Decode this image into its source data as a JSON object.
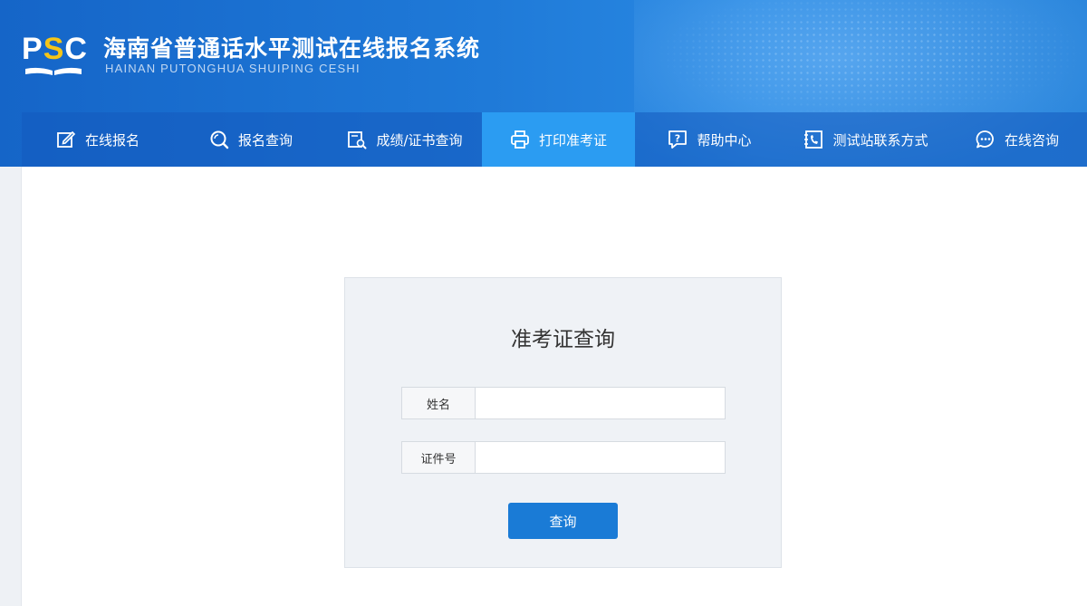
{
  "header": {
    "logo_text": "PSC",
    "title": "海南省普通话水平测试在线报名系统",
    "subtitle": "HAINAN PUTONGHUA SHUIPING CESHI"
  },
  "nav": {
    "items": [
      {
        "label": "在线报名",
        "icon": "edit-icon"
      },
      {
        "label": "报名查询",
        "icon": "search-icon"
      },
      {
        "label": "成绩/证书查询",
        "icon": "certificate-search-icon"
      },
      {
        "label": "打印准考证",
        "icon": "printer-icon",
        "active": true
      },
      {
        "label": "帮助中心",
        "icon": "help-icon"
      },
      {
        "label": "测试站联系方式",
        "icon": "phone-book-icon"
      },
      {
        "label": "在线咨询",
        "icon": "chat-icon"
      }
    ]
  },
  "form": {
    "title": "准考证查询",
    "name_label": "姓名",
    "name_value": "",
    "id_label": "证件号",
    "id_value": "",
    "submit_label": "查询"
  },
  "colors": {
    "header_bg": "#1f7ad8",
    "nav_active": "#2b9cf2",
    "button": "#1a7bd6",
    "logo_accent": "#f5c518"
  }
}
